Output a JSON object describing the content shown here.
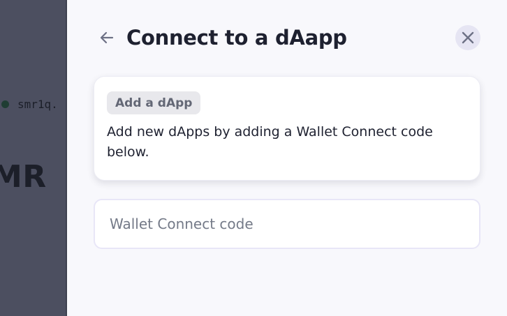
{
  "background": {
    "address": "smr1q.",
    "balance": "MR"
  },
  "drawer": {
    "title": "Connect to a dAapp",
    "back_icon": "arrow-left-icon",
    "close_icon": "close-icon"
  },
  "info_card": {
    "tag": "Add a dApp",
    "text": "Add new dApps by adding a Wallet Connect code below."
  },
  "code_input": {
    "value": "",
    "placeholder": "Wallet Connect code"
  },
  "colors": {
    "overlay": "#4c4f60",
    "drawer_bg": "#f8f8fc",
    "title": "#1e2130",
    "close_bg": "#e6e5f3",
    "tag_bg": "#e8e8ec"
  }
}
